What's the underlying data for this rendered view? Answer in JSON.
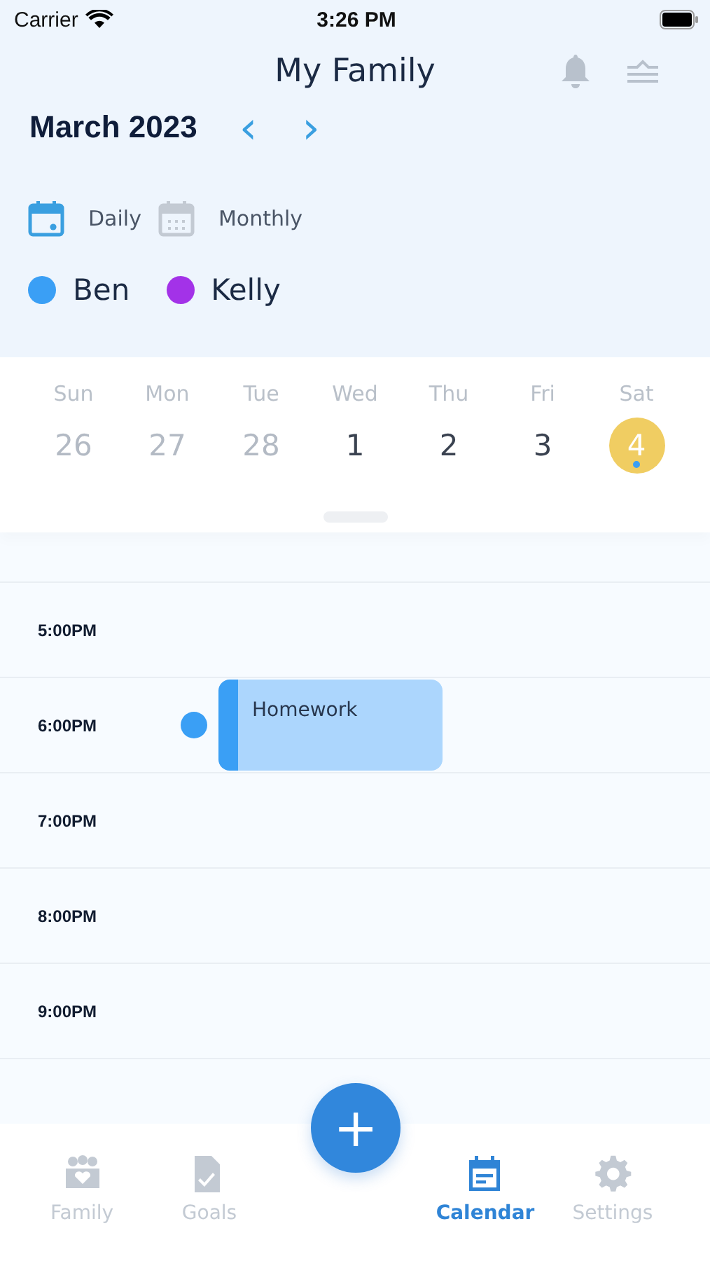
{
  "status_bar": {
    "carrier": "Carrier",
    "time": "3:26 PM"
  },
  "header": {
    "title": "My Family"
  },
  "month": {
    "label": "March 2023",
    "prev": "‹",
    "next": "›"
  },
  "views": [
    {
      "label": "Daily",
      "kind": "daily",
      "selected": true
    },
    {
      "label": "Monthly",
      "kind": "monthly",
      "selected": false
    }
  ],
  "people": [
    {
      "name": "Ben",
      "color": "#3a9ff5"
    },
    {
      "name": "Kelly",
      "color": "#a332e8"
    }
  ],
  "week": [
    {
      "day": "Sun",
      "date": "26",
      "muted": true,
      "selected": false,
      "has_event": false
    },
    {
      "day": "Mon",
      "date": "27",
      "muted": true,
      "selected": false,
      "has_event": false
    },
    {
      "day": "Tue",
      "date": "28",
      "muted": true,
      "selected": false,
      "has_event": false
    },
    {
      "day": "Wed",
      "date": "1",
      "muted": false,
      "selected": false,
      "has_event": false
    },
    {
      "day": "Thu",
      "date": "2",
      "muted": false,
      "selected": false,
      "has_event": false
    },
    {
      "day": "Fri",
      "date": "3",
      "muted": false,
      "selected": false,
      "has_event": false
    },
    {
      "day": "Sat",
      "date": "4",
      "muted": false,
      "selected": true,
      "has_event": true
    }
  ],
  "timeline": [
    {
      "time": "5:00PM"
    },
    {
      "time": "6:00PM",
      "event": {
        "title": "Homework",
        "color": "#3a9ff5"
      }
    },
    {
      "time": "7:00PM"
    },
    {
      "time": "8:00PM"
    },
    {
      "time": "9:00PM"
    }
  ],
  "tab_bar": [
    {
      "label": "Family",
      "kind": "family",
      "selected": false
    },
    {
      "label": "Goals",
      "kind": "goals",
      "selected": false
    },
    {
      "label": "Calendar",
      "kind": "calendar",
      "selected": true
    },
    {
      "label": "Settings",
      "kind": "settings",
      "selected": false
    }
  ],
  "add_button": {
    "label": "+"
  }
}
